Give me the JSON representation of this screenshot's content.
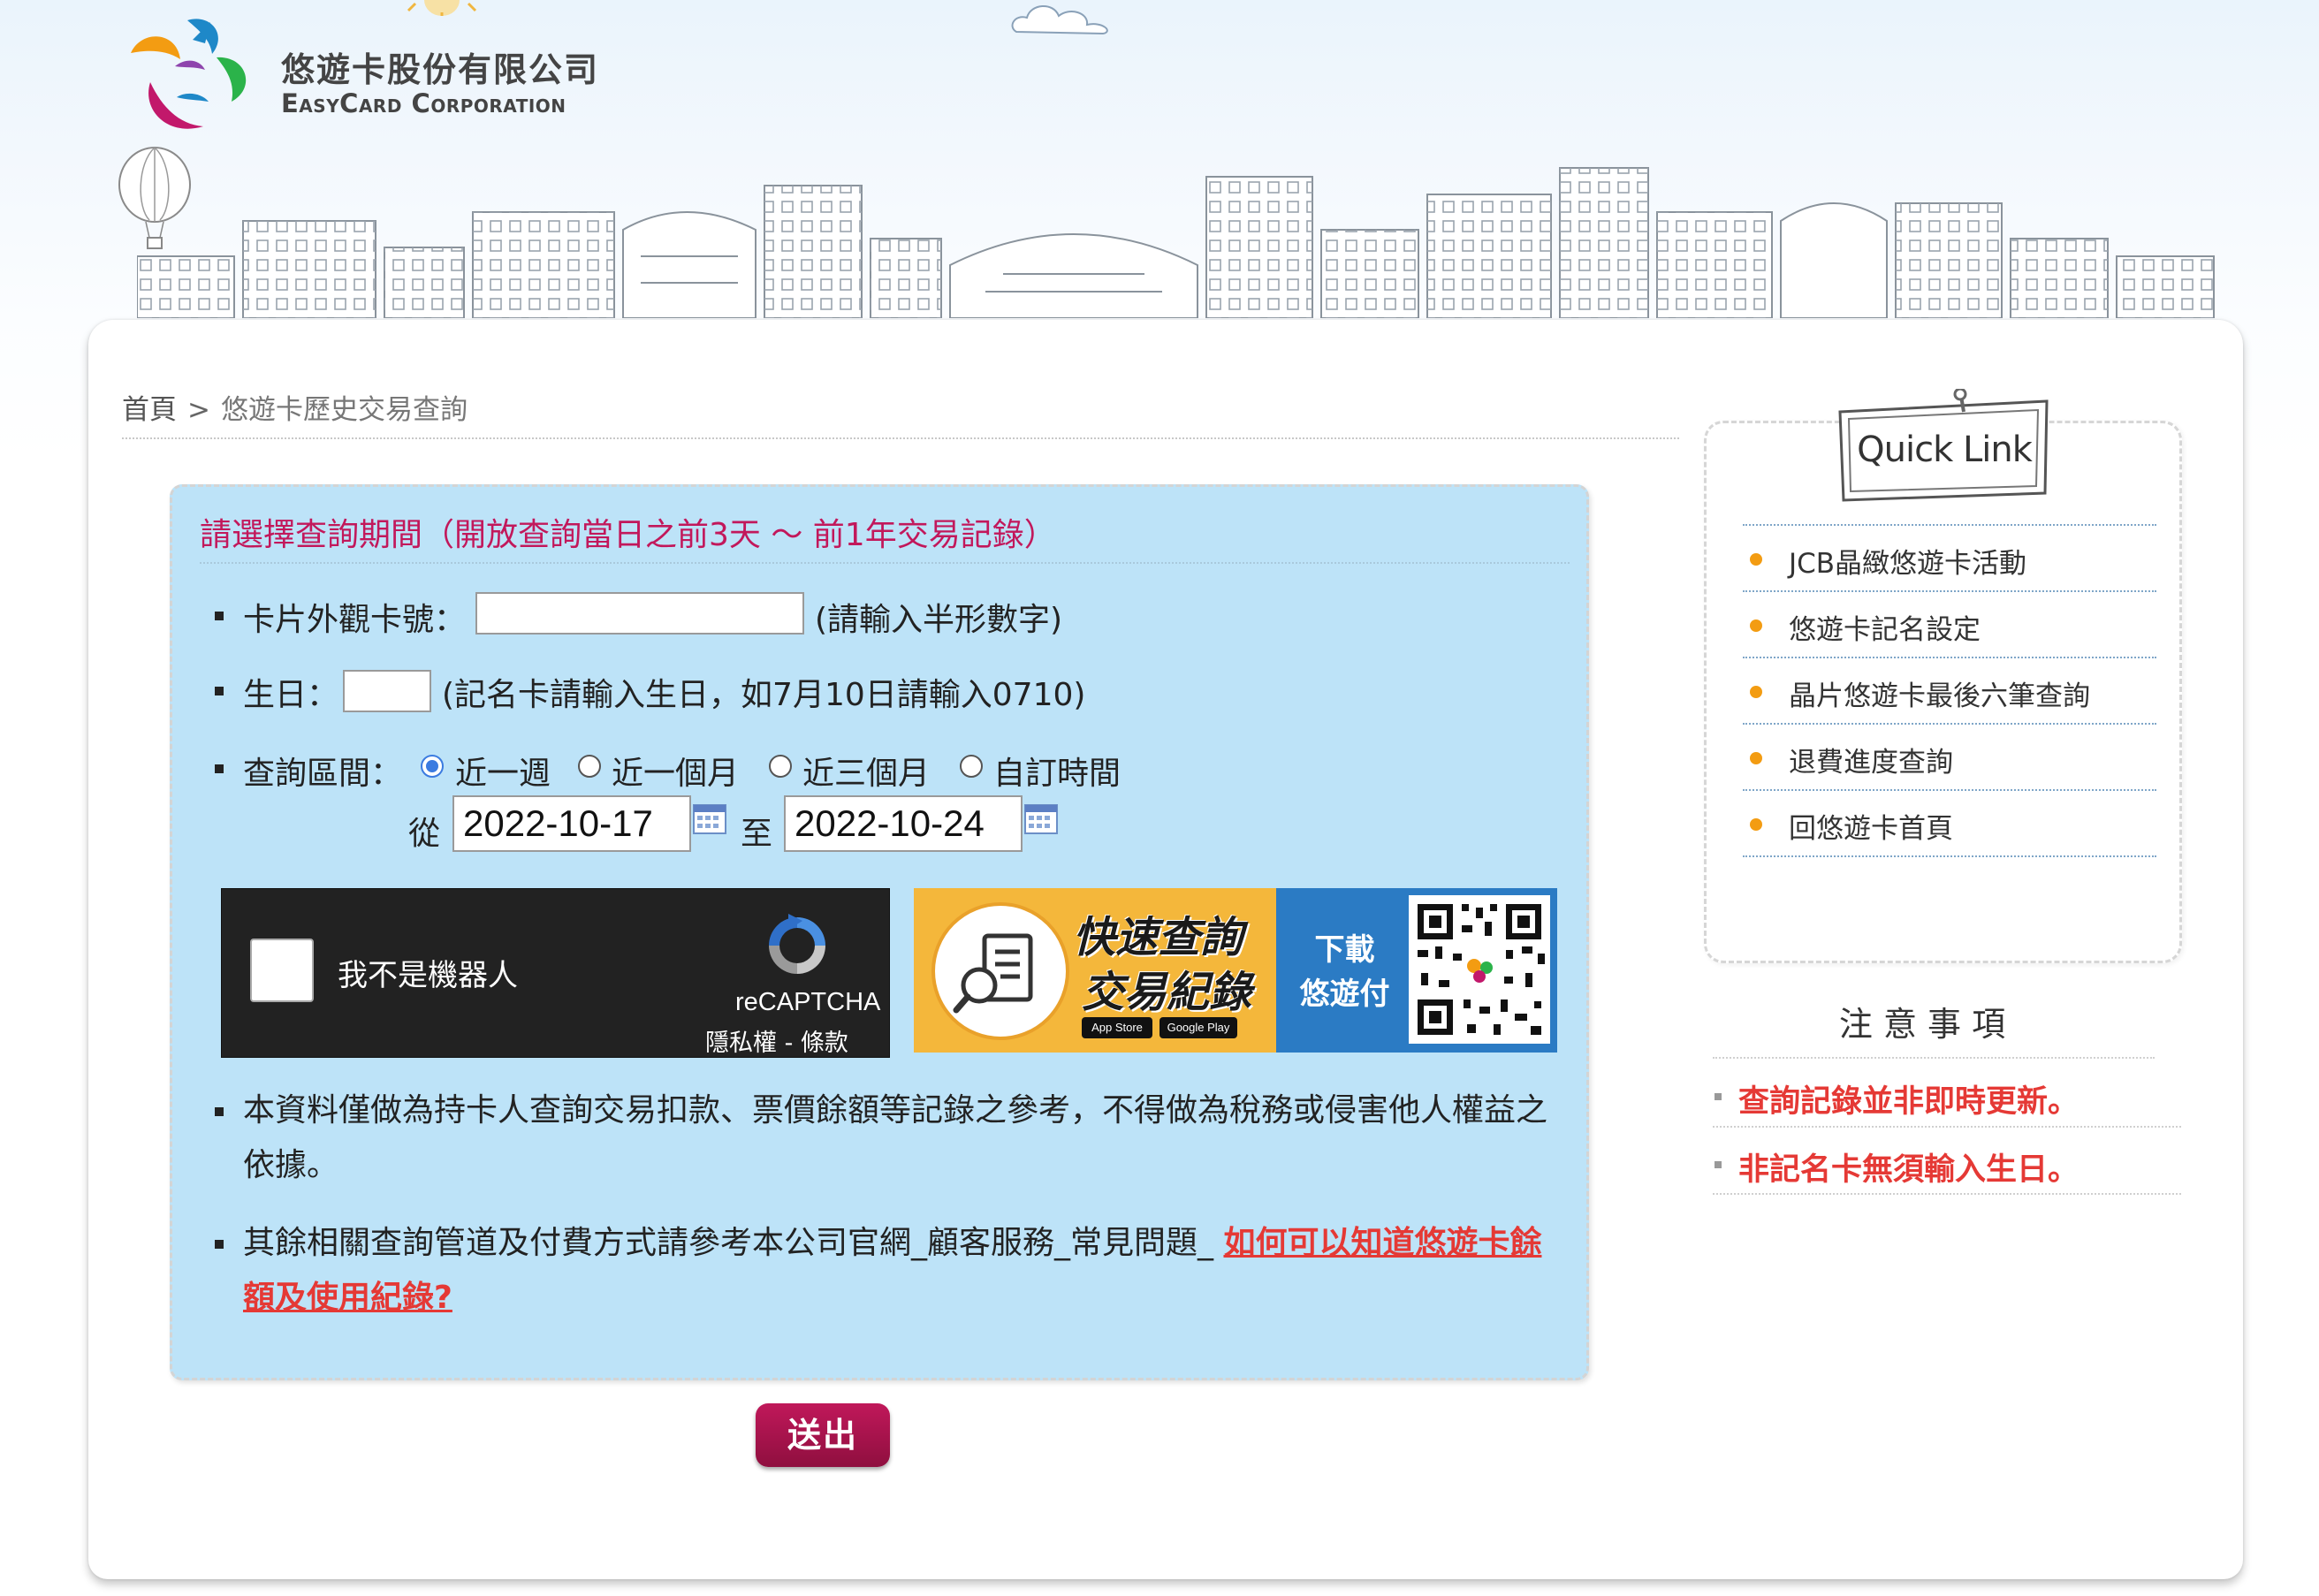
{
  "brand": {
    "name_zh": "悠遊卡股份有限公司",
    "name_en": "EasyCard Corporation"
  },
  "breadcrumb": {
    "home": "首頁",
    "separator": ">",
    "current": "悠遊卡歷史交易查詢"
  },
  "query_form": {
    "title": "請選擇查詢期間（開放查詢當日之前3天 ～ 前1年交易記錄）",
    "card_number": {
      "label": "卡片外觀卡號：",
      "value": "",
      "hint": "(請輸入半形數字)"
    },
    "birthday": {
      "label": "生日：",
      "value": "",
      "hint": "(記名卡請輸入生日，如7月10日請輸入0710)"
    },
    "period": {
      "label": "查詢區間：",
      "options": [
        "近一週",
        "近一個月",
        "近三個月",
        "自訂時間"
      ],
      "selected": "近一週",
      "from_label": "從",
      "from_value": "2022-10-17",
      "to_label": "至",
      "to_value": "2022-10-24"
    }
  },
  "captcha": {
    "label": "我不是機器人",
    "brand": "reCAPTCHA",
    "links": "隱私權 - 條款"
  },
  "app_banner": {
    "headline_1": "快速查詢",
    "headline_2": "交易紀錄",
    "cta_1": "下載",
    "cta_2": "悠遊付",
    "store_1": "App Store",
    "store_2": "Google Play"
  },
  "notes": {
    "note_1": "本資料僅做為持卡人查詢交易扣款、票價餘額等記錄之參考，不得做為稅務或侵害他人權益之依據。",
    "note_2_text": "其餘相關查詢管道及付費方式請參考本公司官網_顧客服務_常見問題_ ",
    "note_2_link": "如何可以知道悠遊卡餘額及使用紀錄?"
  },
  "submit": {
    "label": "送出"
  },
  "quick_link": {
    "title": "Quick Link",
    "items": [
      "JCB晶緻悠遊卡活動",
      "悠遊卡記名設定",
      "晶片悠遊卡最後六筆查詢",
      "退費進度查詢",
      "回悠遊卡首頁"
    ]
  },
  "notice": {
    "title": "注 意 事 項",
    "items": [
      "查詢記錄並非即時更新。",
      "非記名卡無須輸入生日。"
    ]
  },
  "colors": {
    "accent_pink": "#c2185b",
    "panel_blue": "#bde3f8",
    "alert_red": "#e53935",
    "bullet_orange": "#f39c12",
    "banner_yellow": "#f4b73b",
    "banner_blue": "#2b7bc4"
  },
  "icons": {
    "calendar": "calendar-icon",
    "recaptcha": "recaptcha-icon",
    "document_search": "document-search-icon",
    "qr_code": "qr-code-icon"
  }
}
